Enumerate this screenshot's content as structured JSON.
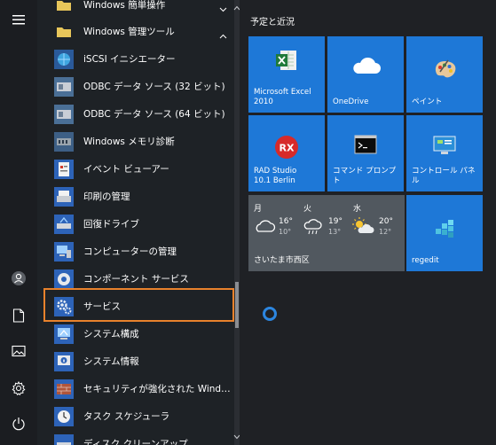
{
  "left_rail": {
    "items": [
      {
        "name": "hamburger-menu-icon"
      },
      {
        "name": "user-icon"
      },
      {
        "name": "documents-icon"
      },
      {
        "name": "pictures-icon"
      },
      {
        "name": "settings-icon"
      },
      {
        "name": "power-icon"
      }
    ]
  },
  "app_list": {
    "groups": [
      {
        "label": "Windows 簡単操作"
      },
      {
        "label": "Windows 管理ツール"
      }
    ],
    "items": [
      {
        "label": "iSCSI イニシエーター",
        "icon": "iscsi-globe-icon"
      },
      {
        "label": "ODBC データ ソース (32 ビット)",
        "icon": "odbc-32-icon"
      },
      {
        "label": "ODBC データ ソース (64 ビット)",
        "icon": "odbc-64-icon"
      },
      {
        "label": "Windows メモリ診断",
        "icon": "memory-diagnostic-icon"
      },
      {
        "label": "イベント ビューアー",
        "icon": "event-viewer-icon"
      },
      {
        "label": "印刷の管理",
        "icon": "print-management-icon"
      },
      {
        "label": "回復ドライブ",
        "icon": "recovery-drive-icon"
      },
      {
        "label": "コンピューターの管理",
        "icon": "computer-management-icon"
      },
      {
        "label": "コンポーネント サービス",
        "icon": "component-services-icon"
      },
      {
        "label": "サービス",
        "icon": "services-gear-icon"
      },
      {
        "label": "システム構成",
        "icon": "system-configuration-icon"
      },
      {
        "label": "システム情報",
        "icon": "system-information-icon"
      },
      {
        "label": "セキュリティが強化された Windows De...",
        "icon": "firewall-icon"
      },
      {
        "label": "タスク スケジューラ",
        "icon": "task-scheduler-icon"
      },
      {
        "label": "ディスク クリーンアップ",
        "icon": "disk-cleanup-icon"
      }
    ]
  },
  "tiles": {
    "group_title": "予定と近況",
    "items": [
      {
        "label": "Microsoft Excel 2010",
        "line1": "Microsoft Excel",
        "line2": "2010",
        "icon": "excel-icon"
      },
      {
        "label": "OneDrive",
        "line1": "OneDrive",
        "line2": "",
        "icon": "onedrive-cloud-icon"
      },
      {
        "label": "ペイント",
        "line1": "ペイント",
        "line2": "",
        "icon": "paint-palette-icon"
      },
      {
        "label": "RAD Studio 10.1 Berlin",
        "line1": "RAD Studio",
        "line2": "10.1 Berlin",
        "icon": "rad-studio-icon",
        "badge": "RX"
      },
      {
        "label": "コマンド プロンプト",
        "line1": "コマンド プロンプト",
        "line2": "",
        "icon": "command-prompt-icon"
      },
      {
        "label": "コントロール パネル",
        "line1": "コントロール パネ",
        "line2": "ル",
        "icon": "control-panel-icon"
      },
      {
        "label": "regedit",
        "line1": "regedit",
        "line2": "",
        "icon": "regedit-icon"
      }
    ],
    "weather": {
      "location": "さいたま市西区",
      "days": [
        {
          "day": "月",
          "high": "16°",
          "low": "10°",
          "icon": "cloudy-icon"
        },
        {
          "day": "火",
          "high": "19°",
          "low": "13°",
          "icon": "rain-icon"
        },
        {
          "day": "水",
          "high": "20°",
          "low": "12°",
          "icon": "partly-sunny-icon"
        }
      ]
    }
  },
  "colors": {
    "tile_blue": "#1e78d7",
    "highlight_orange": "#e8822c",
    "weather_tile": "#51585f",
    "background": "#1e2125"
  }
}
